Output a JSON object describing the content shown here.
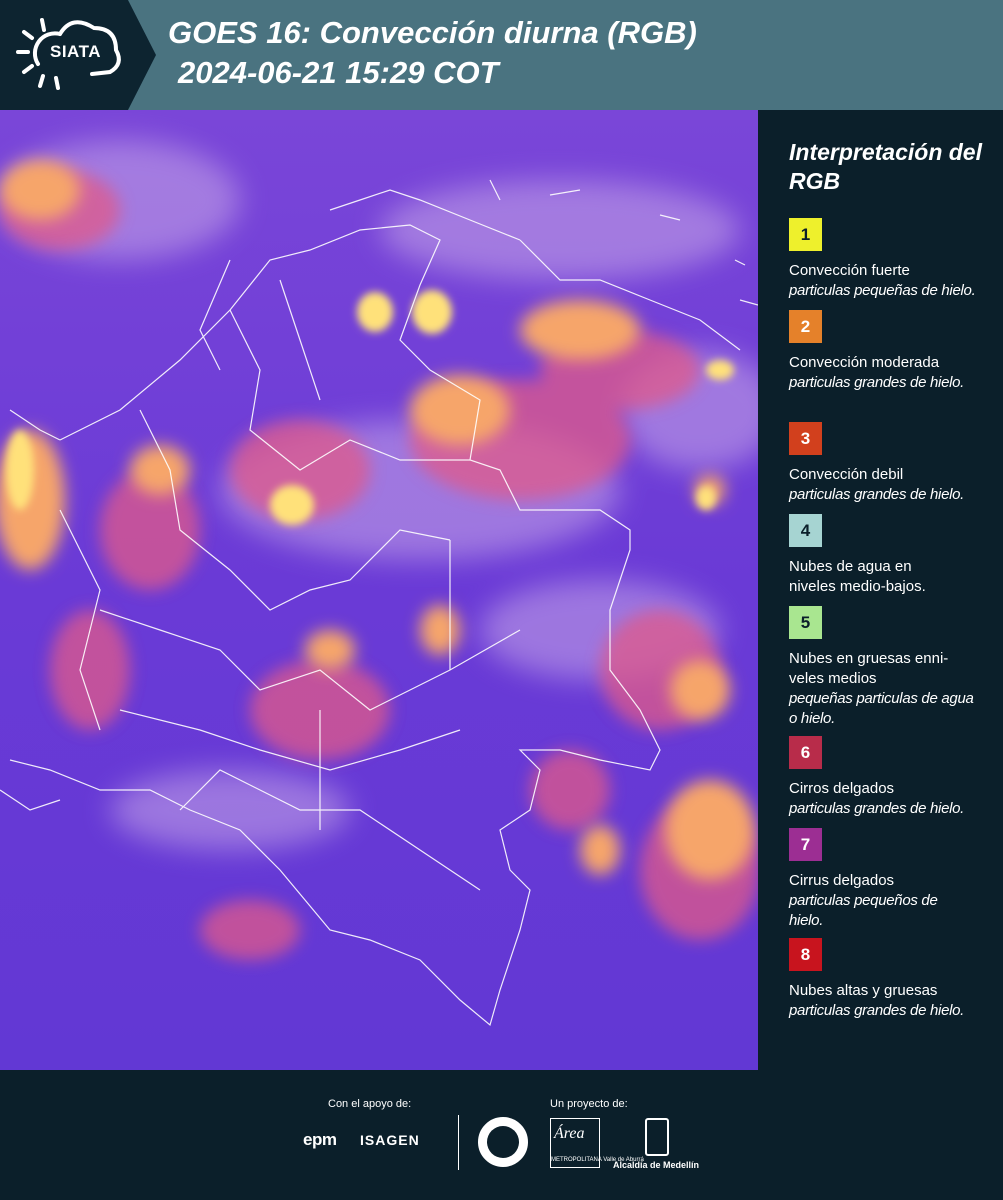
{
  "header": {
    "logo_text": "SIATA",
    "title": "GOES 16: Convección diurna (RGB)",
    "subtitle": "2024-06-21 15:29 COT"
  },
  "legend": {
    "title": "Interpretación del RGB",
    "items": [
      {
        "number": "1",
        "color": "#eef02c",
        "title": "Convección fuerte",
        "subtitle": "particulas pequeñas de hielo."
      },
      {
        "number": "2",
        "color": "#e5812a",
        "title": "Convección moderada",
        "subtitle": "particulas grandes de hielo."
      },
      {
        "number": "3",
        "color": "#d2401d",
        "title": "Convección debil",
        "subtitle": "particulas grandes de hielo."
      },
      {
        "number": "4",
        "color": "#a6d4d2",
        "title": "Nubes de agua en niveles medio-bajos.",
        "subtitle": ""
      },
      {
        "number": "5",
        "color": "#a9e690",
        "title": "Nubes en gruesas enni-veles medios",
        "subtitle": "pequeñas particulas de agua o hielo."
      },
      {
        "number": "6",
        "color": "#b82c4a",
        "title": "Cirros delgados",
        "subtitle": "particulas grandes de hielo."
      },
      {
        "number": "7",
        "color": "#9c2e93",
        "title": "Cirrus delgados",
        "subtitle": "particulas pequeños de hielo."
      },
      {
        "number": "8",
        "color": "#c8141e",
        "title": "Nubes altas y gruesas",
        "subtitle": "particulas grandes de hielo."
      }
    ]
  },
  "footer": {
    "support_label": "Con el apoyo de:",
    "project_label": "Un proyecto de:",
    "epm": "epm",
    "isagen": "ISAGEN",
    "area_logo": "Área",
    "area_sub": "METROPOLITANA Valle de Aburrá",
    "alcaldia": "Alcaldía de Medellín"
  }
}
